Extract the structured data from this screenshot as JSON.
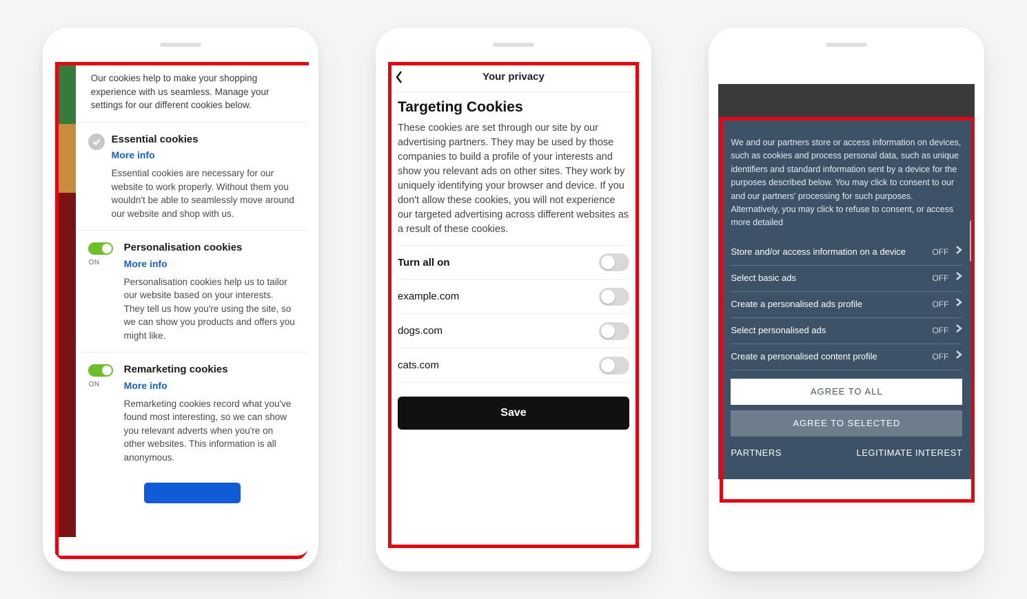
{
  "phone1": {
    "intro": "Our cookies help to make your shopping experience with us seamless. Manage your settings for our different cookies below.",
    "more_info": "More info",
    "on_label": "ON",
    "sections": [
      {
        "title": "Essential cookies",
        "body": "Essential cookies are necessary for our website to work properly. Without them you wouldn't be able to seamlessly move around our website and shop with us."
      },
      {
        "title": "Personalisation cookies",
        "body": "Personalisation cookies help us to tailor our website based on your interests. They tell us how you're using the site, so we can show you products and offers you might like."
      },
      {
        "title": "Remarketing cookies",
        "body": "Remarketing cookies record what you've found most interesting, so we can show you relevant adverts when you're on other websites. This information is all anonymous."
      }
    ]
  },
  "phone2": {
    "header": "Your privacy",
    "heading": "Targeting Cookies",
    "description": "These cookies are set through our site by our advertising partners. They may be used by those companies to build a profile of your interests and show you relevant ads on other sites. They work by uniquely identifying your browser and device. If you don't allow these cookies, you will not experience our targeted advertising across different websites as a result of these cookies.",
    "turn_all": "Turn all on",
    "rows": [
      "example.com",
      "dogs.com",
      "cats.com"
    ],
    "save": "Save"
  },
  "phone3": {
    "intro": "We and our partners store or access information on devices, such as cookies and process personal data, such as unique identifiers and standard information sent by a device for the purposes described below. You may click to consent to our and our partners' processing for such purposes. Alternatively, you may click to refuse to consent, or access more detailed",
    "off": "OFF",
    "rows": [
      "Store and/or access information on a device",
      "Select basic ads",
      "Create a personalised ads profile",
      "Select personalised ads",
      "Create a personalised content profile"
    ],
    "agree_all": "AGREE TO ALL",
    "agree_selected": "AGREE TO SELECTED",
    "partners": "PARTNERS",
    "legit": "LEGITIMATE INTEREST"
  }
}
